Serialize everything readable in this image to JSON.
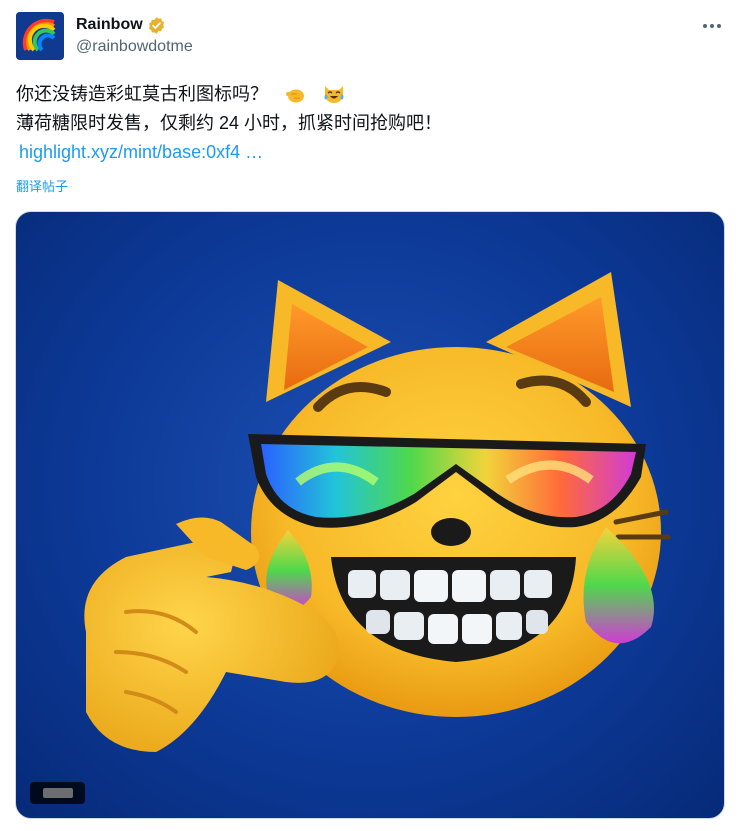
{
  "author": {
    "display_name": "Rainbow",
    "handle": "@rainbowdotme",
    "verified": true,
    "badge_color": "#e8b12b",
    "avatar_icon": "rainbow-icon"
  },
  "tweet": {
    "line1": "你还没铸造彩虹莫古利图标吗？",
    "line1_emojis": [
      "pointing-hand-emoji",
      "laughing-cat-emoji"
    ],
    "line2": "薄荷糖限时发售，仅剩约 24 小时，抓紧时间抢购吧！",
    "link": "highlight.xyz/mint/base:0xf4 …",
    "translate_label": "翻译帖子"
  },
  "media": {
    "description_icon": "cat-emoji-rainbow-sunglasses-image",
    "background_color": "#0d3a98",
    "accent_color": "#f7b928"
  },
  "colors": {
    "link": "#1d9bf0",
    "text": "#0f1419",
    "secondary": "#536471"
  }
}
